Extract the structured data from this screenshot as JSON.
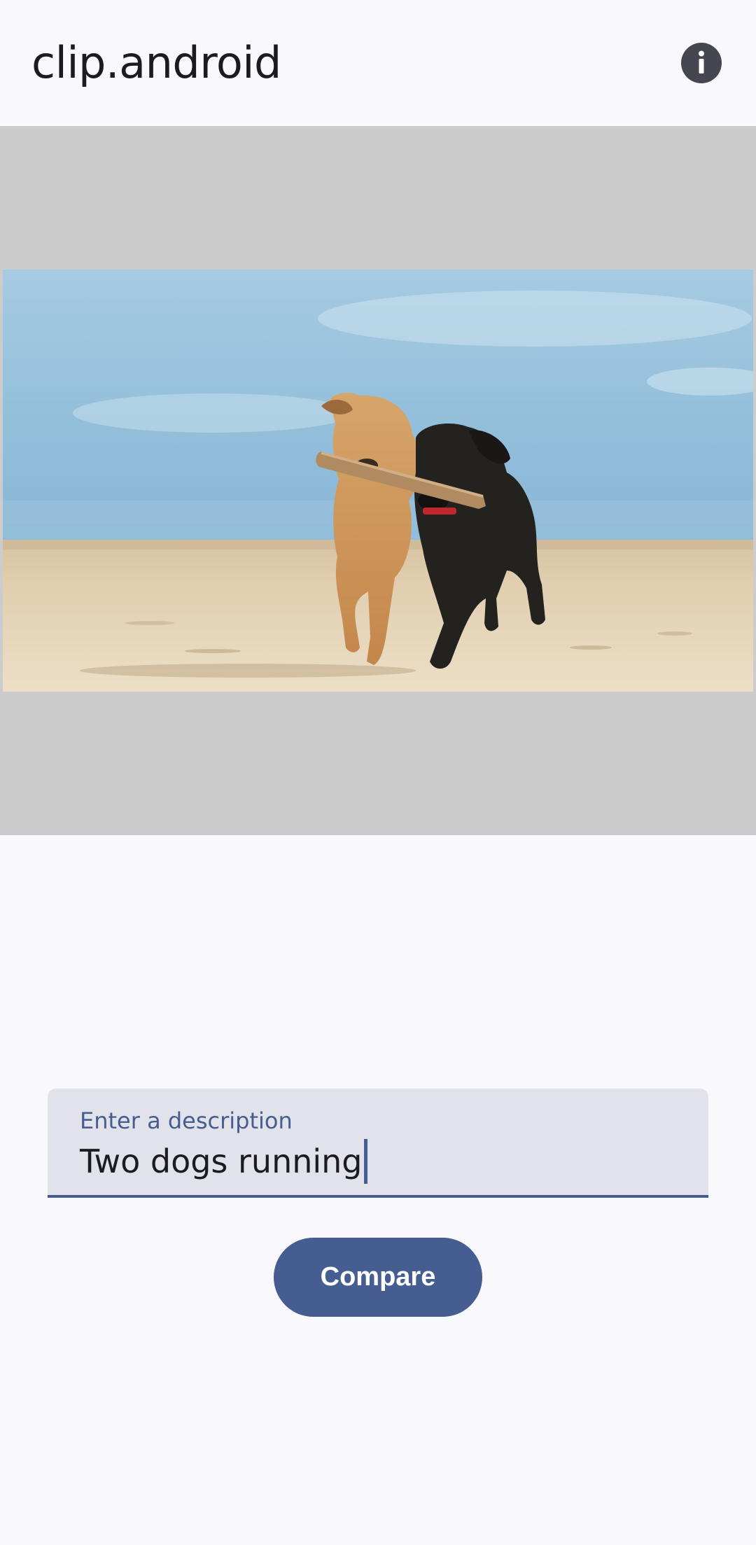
{
  "app_bar": {
    "title": "clip.android",
    "info_icon": "info-icon"
  },
  "image_viewer": {
    "image_subject": "two dogs running on a beach carrying a stick"
  },
  "description_field": {
    "label": "Enter a description",
    "value": "Two dogs running"
  },
  "compare_button": {
    "label": "Compare"
  },
  "colors": {
    "background": "#f9f8fd",
    "primary": "#465d91",
    "field_background": "#e2e2eb",
    "image_area_background": "#cccccc",
    "on_surface": "#1b1b21"
  }
}
